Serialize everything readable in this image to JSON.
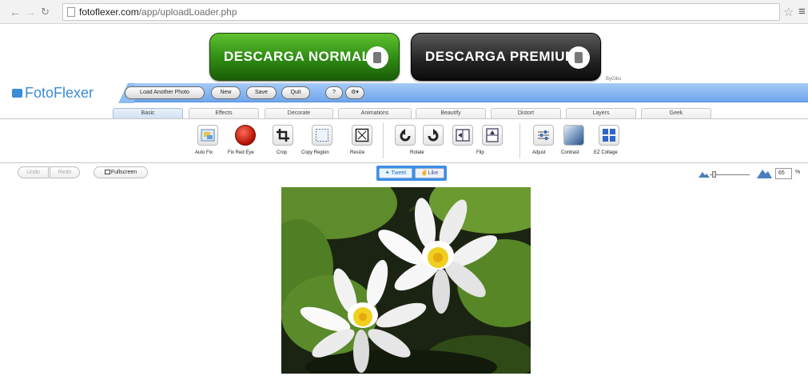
{
  "browser": {
    "back_icon": "arrow-left-icon",
    "forward_icon": "arrow-right-icon",
    "reload_icon": "reload-icon",
    "url_host": "fotoflexer.com",
    "url_path": "/app/uploadLoader.php"
  },
  "ads": {
    "normal_label": "DESCARGA NORMAL",
    "premium_label": "DESCARGA PREMIUM",
    "tiny_text": "ByGibs"
  },
  "header": {
    "logo": "FotoFlexer",
    "buttons": [
      "Load Another Photo",
      "New",
      "Save",
      "Quit",
      "?",
      "⚙▾"
    ],
    "accent": "#3a8cd8"
  },
  "tabs": [
    "Basic",
    "Effects",
    "Decorate",
    "Animations",
    "Beautify",
    "Distort",
    "Layers",
    "Geek"
  ],
  "active_tab": "Basic",
  "tools": {
    "auto_fix": "Auto Fix",
    "fix_red_eye": "Fix Red Eye",
    "crop": "Crop",
    "copy_region": "Copy Region",
    "resize": "Resize",
    "rotate": "Rotate",
    "flip": "Flip",
    "adjust": "Adjust",
    "contrast": "Contrast",
    "ez_collage": "EZ Collage"
  },
  "subbar": {
    "undo": "Undo",
    "redo": "Redo",
    "fullscreen": "Fullscreen",
    "tweet": "Tweet",
    "like": "Like"
  },
  "zoom": {
    "value": "65",
    "unit": "%"
  }
}
